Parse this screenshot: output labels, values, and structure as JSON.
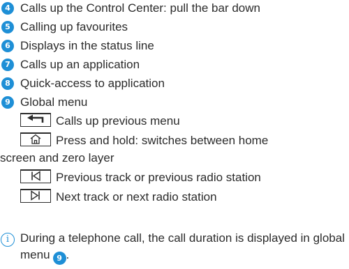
{
  "items": [
    {
      "num": "4",
      "text": "Calls up the Control Center: pull the bar down"
    },
    {
      "num": "5",
      "text": "Calling up favourites"
    },
    {
      "num": "6",
      "text": "Displays in the status line"
    },
    {
      "num": "7",
      "text": "Calls up an application"
    },
    {
      "num": "8",
      "text": "Quick-access to application"
    },
    {
      "num": "9",
      "text": "Global menu"
    }
  ],
  "global_menu": [
    {
      "icon": "back-arrow-icon",
      "text": "Calls up previous menu"
    },
    {
      "icon": "home-icon",
      "text": "Press and hold: switches between home",
      "text_cont": "screen and zero layer"
    },
    {
      "icon": "previous-track-icon",
      "text": "Previous track or previous radio station"
    },
    {
      "icon": "next-track-icon",
      "text": "Next track or next radio station"
    }
  ],
  "note": {
    "text": "During a telephone call, the call duration is displayed in global menu",
    "ref_num": "9",
    "end": "."
  },
  "colors": {
    "accent": "#1e8fd6",
    "text": "#2b2b2b"
  }
}
